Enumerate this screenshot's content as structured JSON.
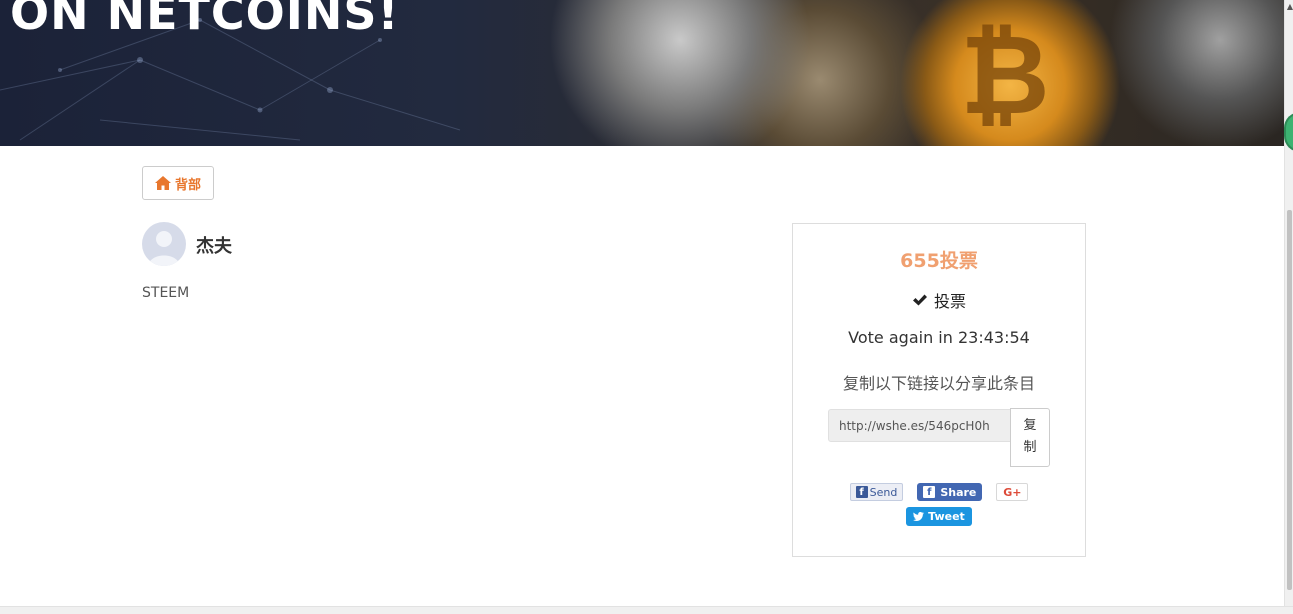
{
  "banner": {
    "title": "ON NETCOINS!"
  },
  "back_button": {
    "label": "背部",
    "icon": "home-icon"
  },
  "author": {
    "name": "杰夫",
    "avatar_icon": "default-avatar-icon"
  },
  "item": {
    "text": "STEEM"
  },
  "vote_card": {
    "vote_count": "655投票",
    "vote_label": "投票",
    "vote_icon": "check-icon",
    "vote_again": "Vote again in 23:43:54",
    "share_hint": "复制以下链接以分享此条目",
    "share_link": "http://wshe.es/546pcH0h",
    "copy_label": "复制",
    "social": {
      "fb_send": "Send",
      "fb_share": "Share",
      "gplus": "G+",
      "tweet": "Tweet"
    }
  },
  "colors": {
    "accent_orange": "#e8772e",
    "vote_count": "#f0a070",
    "facebook": "#4267b2",
    "twitter": "#1b95e0",
    "gplus": "#dd4b39"
  }
}
